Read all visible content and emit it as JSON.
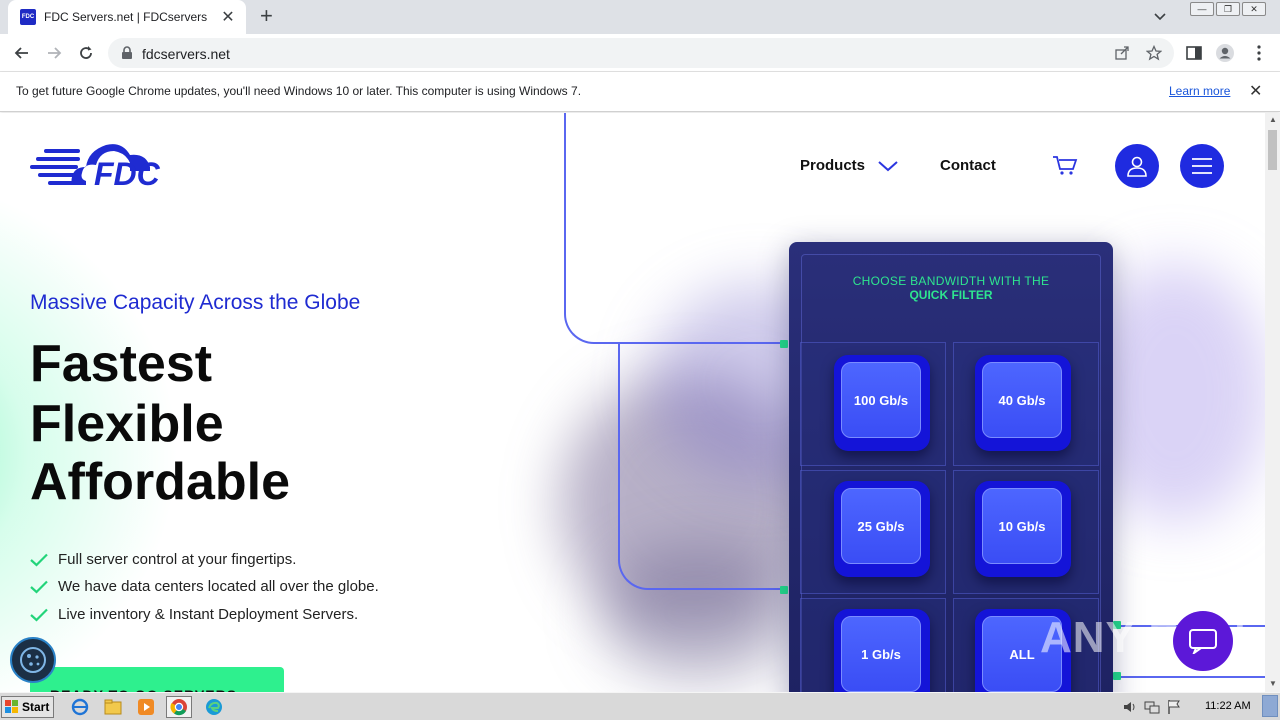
{
  "browser": {
    "tab_title": "FDC Servers.net | FDCservers",
    "favicon_text": "FDC",
    "url": "fdcservers.net",
    "infobar_text": "To get future Google Chrome updates, you'll need Windows 10 or later. This computer is using Windows 7.",
    "infobar_link": "Learn more"
  },
  "site": {
    "logo_text": "FDC",
    "nav": {
      "products": "Products",
      "contact": "Contact"
    },
    "subhead": "Massive Capacity Across the Globe",
    "headlines": [
      "Fastest",
      "Flexible",
      "Affordable"
    ],
    "features": [
      "Full server control at your fingertips.",
      "We have data centers located all over the globe.",
      "Live inventory & Instant Deployment Servers."
    ],
    "cta": "READY TO GO SERVERS →",
    "filter": {
      "title_line1": "CHOOSE BANDWIDTH WITH THE",
      "title_line2": "QUICK FILTER",
      "options": [
        "100 Gb/s",
        "40 Gb/s",
        "25 Gb/s",
        "10 Gb/s",
        "1 Gb/s",
        "ALL"
      ]
    },
    "watermark": "ANY RUN"
  },
  "taskbar": {
    "start_label": "Start",
    "clock": "11:22 AM"
  },
  "colors": {
    "brand_blue": "#1f2be0",
    "accent_green": "#2ef08e",
    "panel_bg": "#23286c"
  }
}
